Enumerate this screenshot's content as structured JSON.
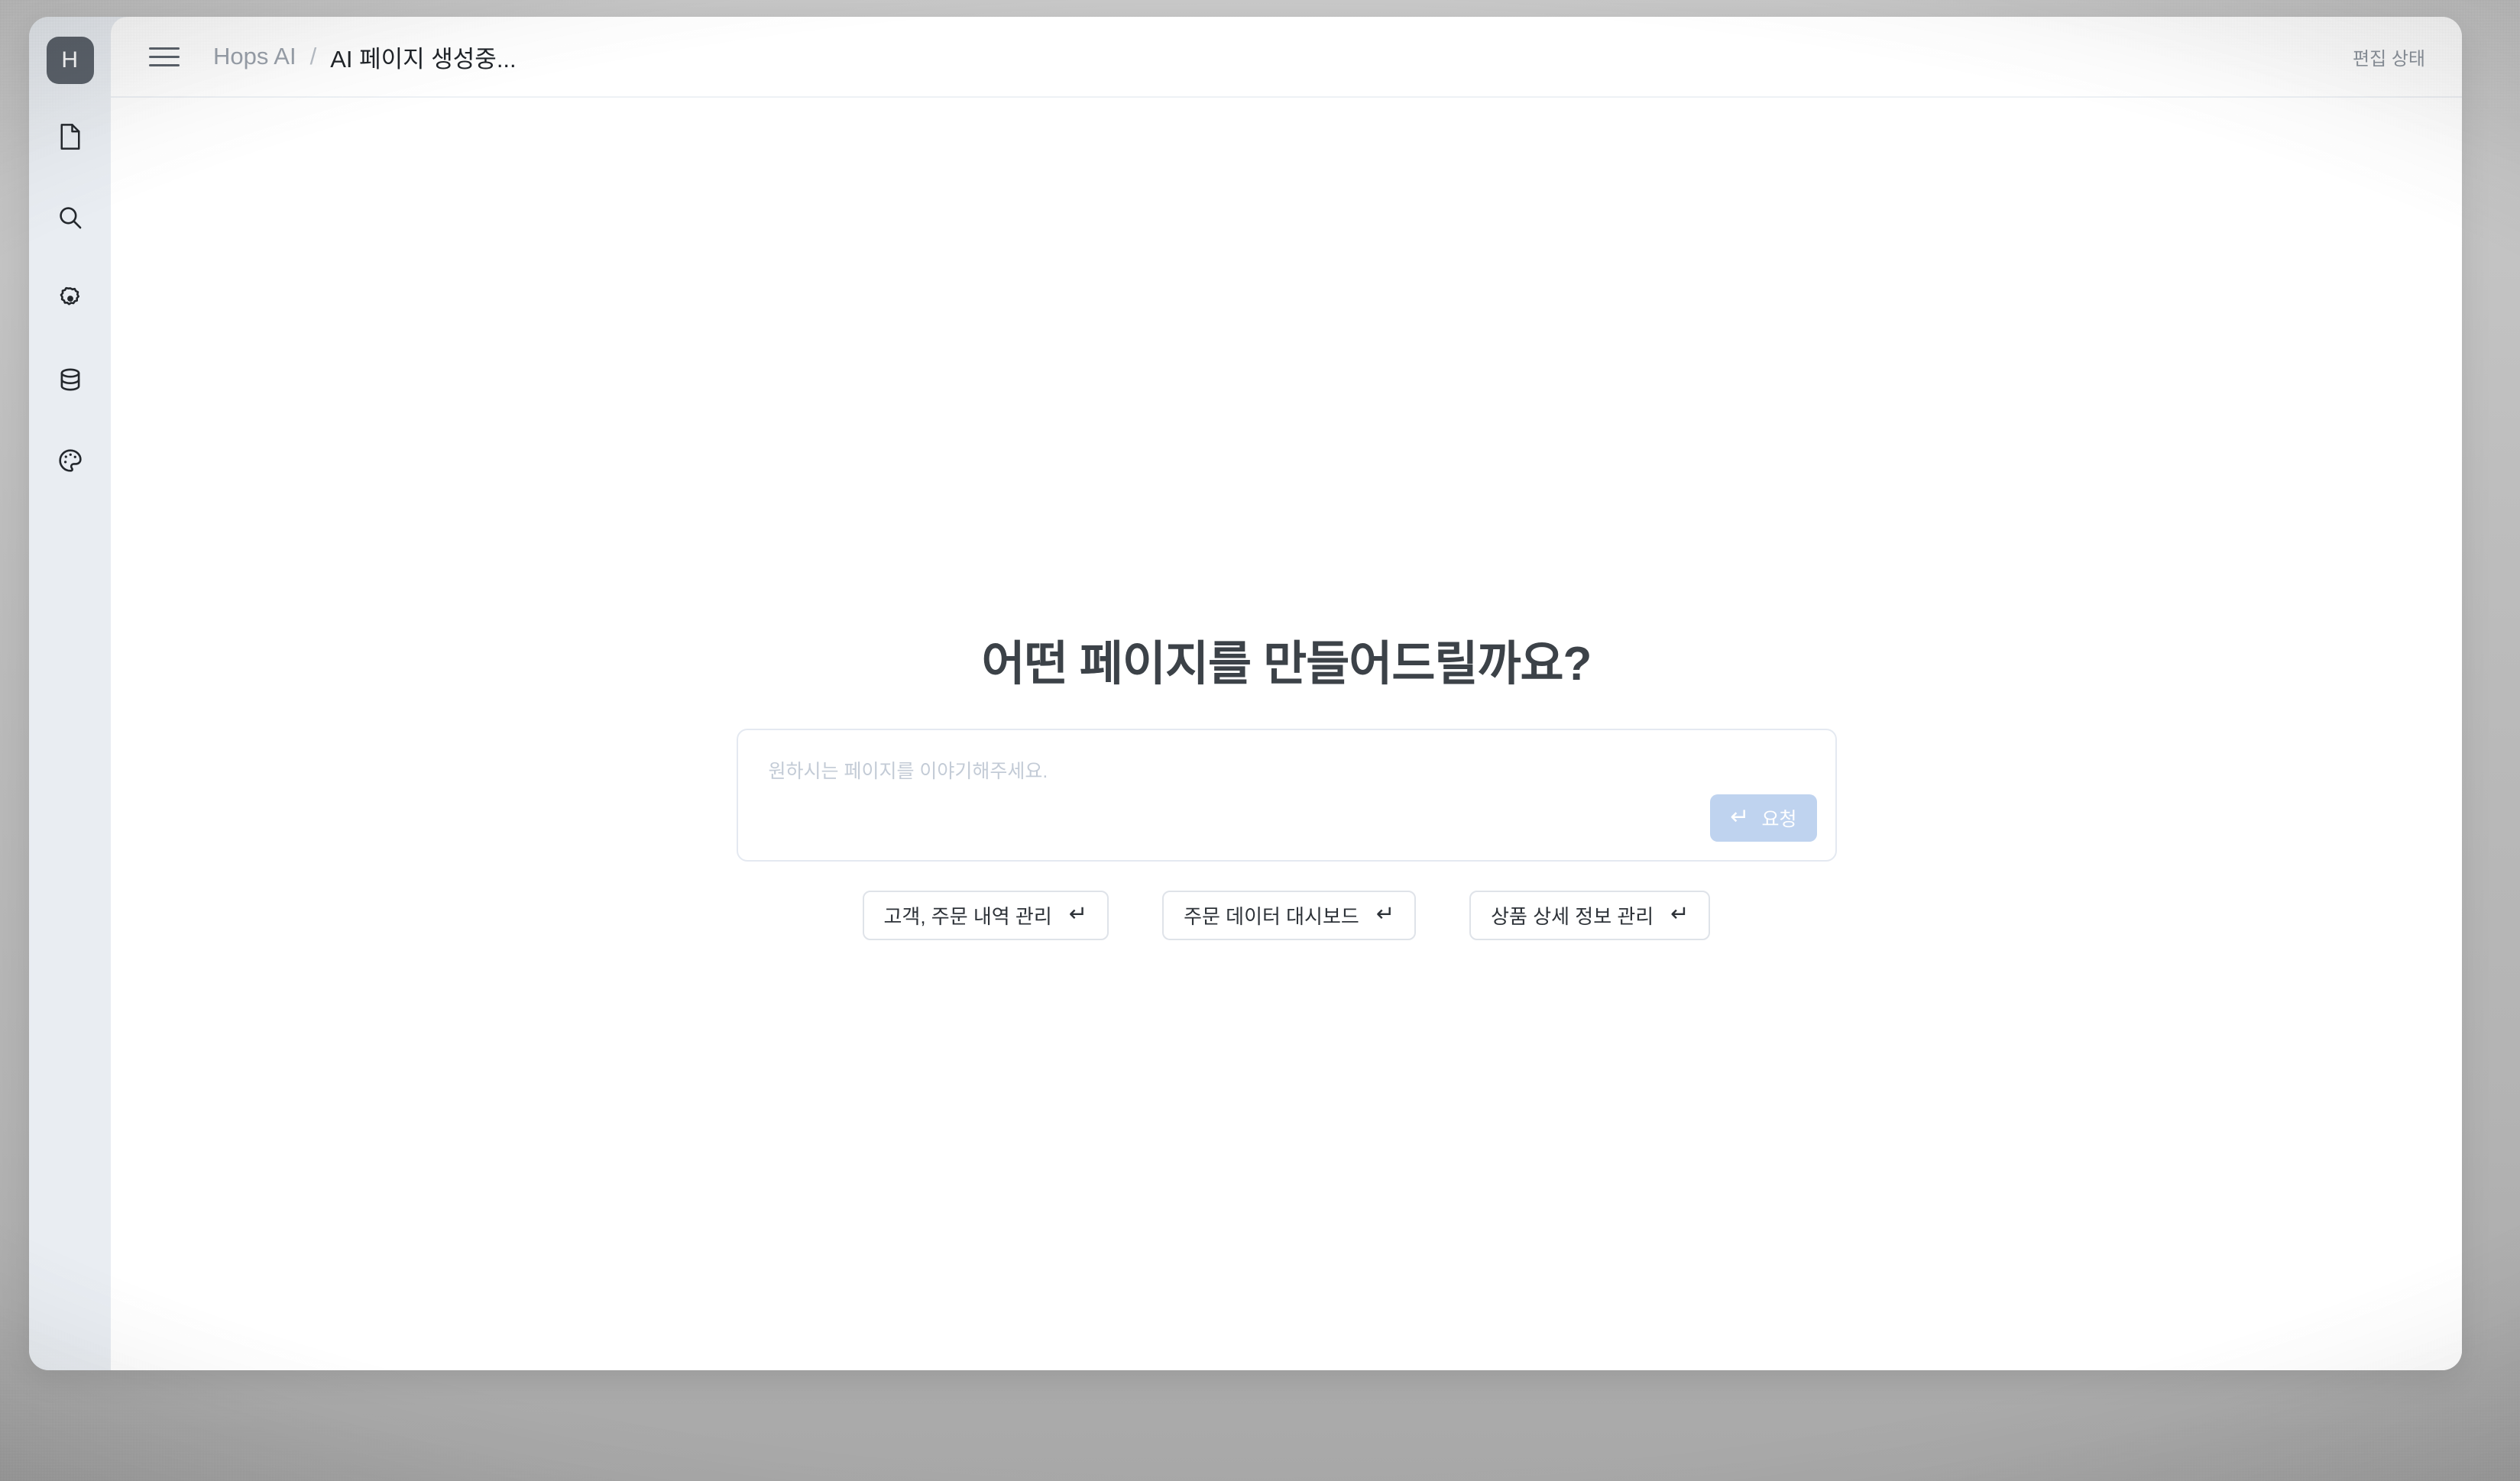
{
  "window": {
    "logo_letter": "H"
  },
  "sidebar": {
    "items": [
      {
        "icon": "file-page-icon",
        "name": "sidebar-item-pages"
      },
      {
        "icon": "search-icon",
        "name": "sidebar-item-search"
      },
      {
        "icon": "gear-icon",
        "name": "sidebar-item-settings"
      },
      {
        "icon": "database-icon",
        "name": "sidebar-item-database"
      },
      {
        "icon": "palette-icon",
        "name": "sidebar-item-theme"
      }
    ]
  },
  "header": {
    "menu_icon": "hamburger-icon",
    "breadcrumb": {
      "root": "Hops AI",
      "separator": "/",
      "current": "AI 페이지 생성중..."
    },
    "status": "편집 상태"
  },
  "main": {
    "title": "어떤 페이지를 만들어드릴까요?",
    "prompt": {
      "value": "",
      "placeholder": "원하시는 페이지를 이야기해주세요.",
      "submit_label": "요청",
      "submit_glyph": "↵",
      "submit_color": "#bfd3ef"
    },
    "suggestions": [
      {
        "label": "고객, 주문 내역 관리",
        "glyph": "↵"
      },
      {
        "label": "주문 데이터 대시보드",
        "glyph": "↵"
      },
      {
        "label": "상품 상세 정보 관리",
        "glyph": "↵"
      }
    ]
  },
  "colors": {
    "rail_bg": "#e9edf2",
    "logo_bg": "#5c636c",
    "accent": "#bfd3ef",
    "title": "#3c4248",
    "muted": "#9aa1ab"
  }
}
